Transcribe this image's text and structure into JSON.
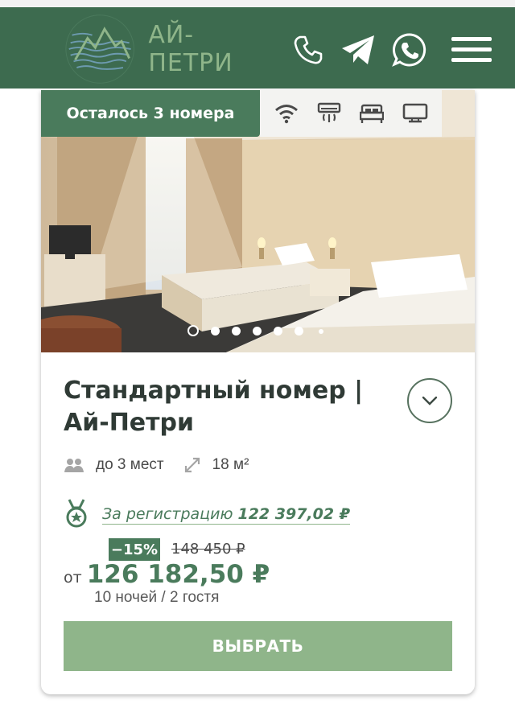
{
  "header": {
    "logo_text": "АЙ-ПЕТРИ",
    "background": "#3d6b4f",
    "icons": [
      "phone-icon",
      "telegram-icon",
      "whatsapp-icon",
      "menu-icon"
    ]
  },
  "room": {
    "availability": "Осталось 3 номера",
    "amenities": [
      "wifi-icon",
      "air-conditioner-icon",
      "bed-icon",
      "tv-icon"
    ],
    "gallery": {
      "slides_total": 7,
      "active_slide": 1
    },
    "title": "Стандартный номер | Ай-Петри",
    "capacity": "до 3 мест",
    "area": "18 м²",
    "registration_label": "За регистрацию",
    "registration_price": "122 397,02 ₽",
    "discount": "−15%",
    "old_price": "148 450 ₽",
    "price_prefix": "от",
    "price": "126 182,50 ₽",
    "stay_info": "10 ночей / 2 гостя",
    "select_button": "ВЫБРАТЬ"
  },
  "colors": {
    "brand_green": "#3d6b4f",
    "accent_green": "#4a7b5c",
    "button_green": "#8fb58a",
    "logo_green": "#8fb58a"
  }
}
